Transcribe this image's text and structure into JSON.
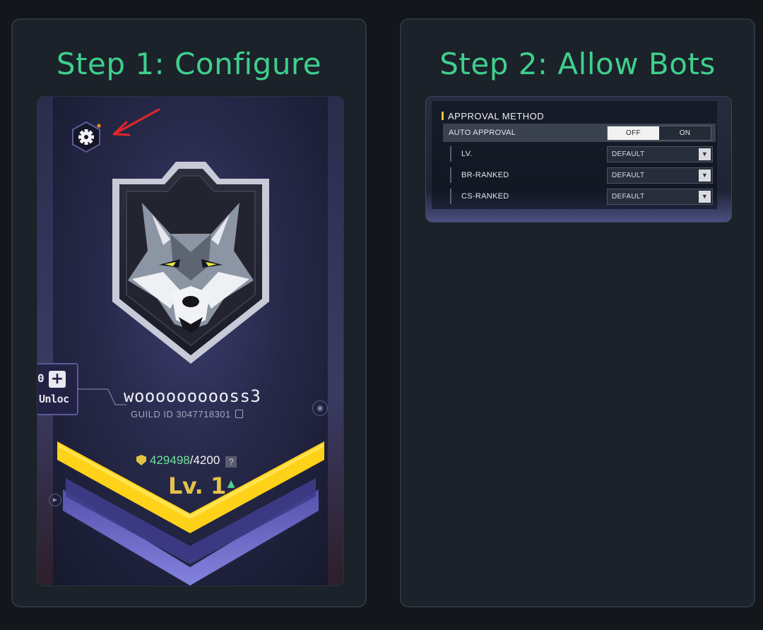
{
  "step1": {
    "title": "Step 1: Configure",
    "side_tab": {
      "count": "0",
      "plus": "+",
      "label": "Unloc"
    },
    "guild": {
      "name": "woooooooooss3",
      "id_label": "GUILD ID 3047718301"
    },
    "points": {
      "current": "429498",
      "separator": "/",
      "max": "4200",
      "help": "?"
    },
    "level": {
      "text": "Lv. 1",
      "up_icon": "▲"
    },
    "icons": [
      "gear-icon",
      "red-arrow-annotation",
      "wolf-emblem",
      "copy-icon",
      "shield-icon"
    ]
  },
  "step2": {
    "title": "Step 2: Allow Bots",
    "section_title": "APPROVAL METHOD",
    "auto_approval": {
      "label": "AUTO APPROVAL",
      "off": "OFF",
      "on": "ON",
      "selected": "OFF"
    },
    "filters": [
      {
        "label": "LV.",
        "value": "DEFAULT"
      },
      {
        "label": "BR-RANKED",
        "value": "DEFAULT"
      },
      {
        "label": "CS-RANKED",
        "value": "DEFAULT"
      }
    ],
    "dropdown_arrow": "▼"
  },
  "colors": {
    "accent_green": "#3fcf8e",
    "level_gold": "#e6c24a",
    "points_green": "#6ee39a",
    "yellow_bar": "#ffd21a",
    "red_arrow": "#e3262a"
  }
}
